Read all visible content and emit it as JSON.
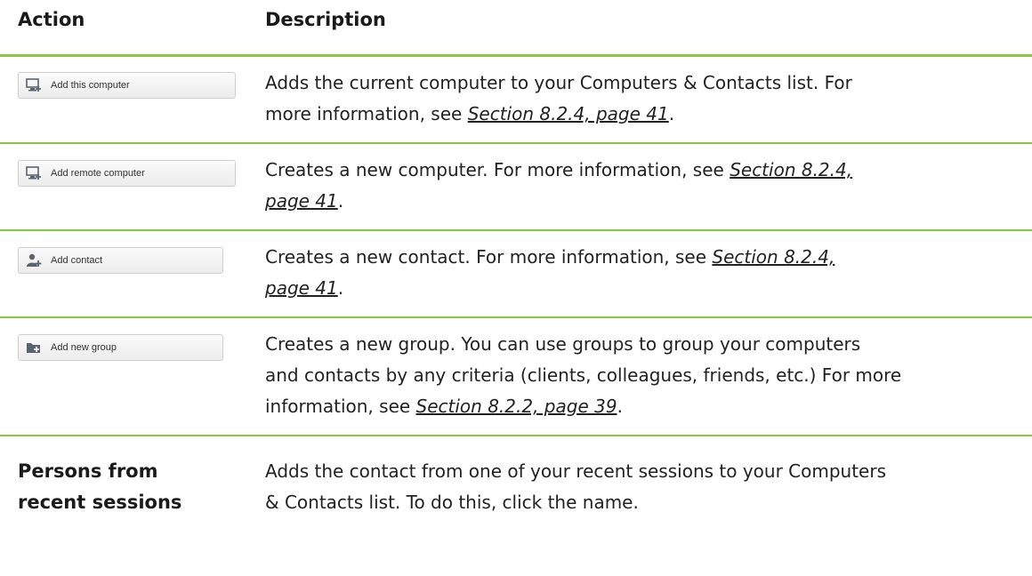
{
  "header": {
    "action_label": "Action",
    "description_label": "Description"
  },
  "rows": [
    {
      "button_label": "Add this computer",
      "icon": "computer-add-icon",
      "desc_lines": [
        [
          "Adds the current computer to your Computers & Contacts list. For"
        ],
        [
          "more information, see ",
          "Section 8.2.4, page 41",
          "."
        ]
      ]
    },
    {
      "button_label": "Add remote computer",
      "icon": "computer-add-icon",
      "desc_lines": [
        [
          "Creates a new computer. For more information, see ",
          "Section 8.2.4,"
        ],
        [
          "page 41",
          "."
        ]
      ]
    },
    {
      "button_label": "Add contact",
      "icon": "contact-add-icon",
      "desc_lines": [
        [
          "Creates a new contact. For more information, see ",
          "Section 8.2.4,"
        ],
        [
          "page 41",
          "."
        ]
      ]
    },
    {
      "button_label": "Add new group",
      "icon": "folder-add-icon",
      "desc_lines": [
        [
          "Creates a new group. You can use groups to group your computers"
        ],
        [
          "and contacts by any criteria (clients, colleagues, friends, etc.) For more"
        ],
        [
          "information, see ",
          "Section 8.2.2, page 39",
          "."
        ]
      ]
    },
    {
      "action_text_lines": [
        "Persons from",
        "recent sessions"
      ],
      "desc_lines": [
        [
          "Adds the contact from one of your recent sessions to your Computers"
        ],
        [
          "& Contacts list. To do this, click the name."
        ]
      ]
    }
  ],
  "colors": {
    "rule": "#8cc63e",
    "text": "#222222"
  }
}
